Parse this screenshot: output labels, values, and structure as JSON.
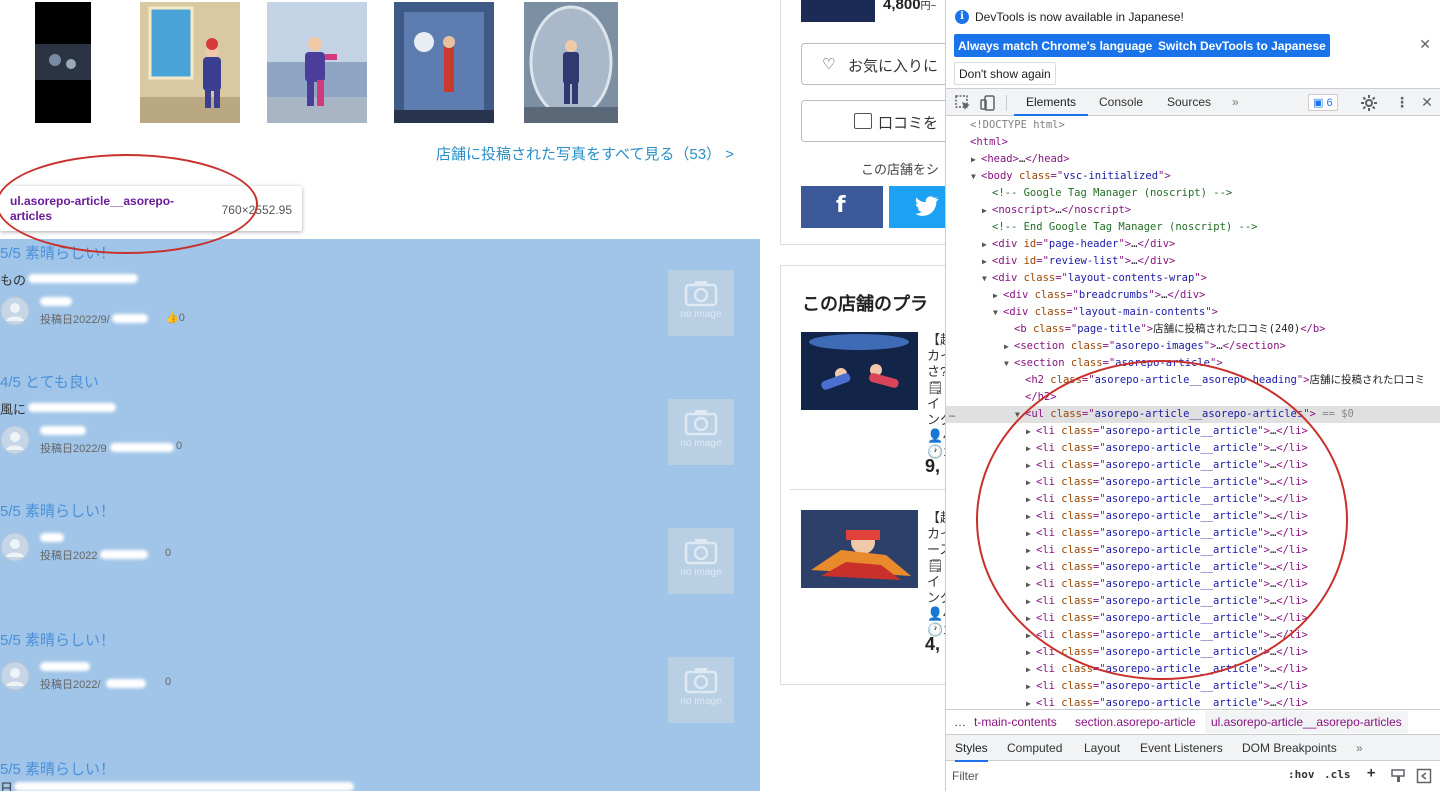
{
  "page": {
    "see_all_link": "店舗に投稿された写真をすべて見る（53） >",
    "price_top": "4,800",
    "price_top_unit": "円~",
    "favorite_button": "お気に入りに",
    "review_button": "口コミを",
    "share_label": "この店舗をシ",
    "plan_title": "この店舗のプラ",
    "plans": [
      {
        "lines": [
          "【超",
          "カイ",
          "さ?",
          "🗒イ",
          "ング",
          "👤4",
          "🕐1"
        ],
        "price": "9,"
      },
      {
        "lines": [
          "【超",
          "カイ",
          "ース",
          "🗒イ",
          "ング",
          "👤4",
          "🕐1"
        ],
        "price": "4,"
      }
    ],
    "no_image_label": "no image"
  },
  "tooltip": {
    "selector": "ul.asorepo-article__asorepo-articles",
    "dimensions": "760×2552.95"
  },
  "reviews": [
    {
      "rating": "5/5 素晴らしい！",
      "text": "もの",
      "posted": "投稿日2022/9/",
      "likes": "0"
    },
    {
      "rating": "4/5 とても良い",
      "text": "風に",
      "posted": "投稿日2022/9",
      "likes": "0"
    },
    {
      "rating": "5/5 素晴らしい！",
      "text": "",
      "posted": "投稿日2022",
      "likes": "0"
    },
    {
      "rating": "5/5 素晴らしい！",
      "text": "",
      "posted": "投稿日2022/",
      "likes": "0"
    },
    {
      "rating": "5/5 素晴らしい！",
      "text": "日",
      "posted": "",
      "likes": ""
    }
  ],
  "devtools": {
    "info_message": "DevTools is now available in Japanese!",
    "btn_match_language": "Always match Chrome's language",
    "btn_switch_japanese": "Switch DevTools to Japanese",
    "btn_dont_show": "Don't show again",
    "tabs": [
      "Elements",
      "Console",
      "Sources"
    ],
    "more_tabs": "»",
    "issues_count": "6",
    "dom_lines": [
      {
        "indent": 0,
        "tri": "",
        "parts": [
          [
            "doctype",
            "<!DOCTYPE html>"
          ]
        ]
      },
      {
        "indent": 0,
        "tri": "",
        "parts": [
          [
            "tag",
            "<html>"
          ]
        ]
      },
      {
        "indent": 1,
        "tri": "▶",
        "parts": [
          [
            "tag",
            "<head>"
          ],
          [
            "txt",
            "…"
          ],
          [
            "tag",
            "</head>"
          ]
        ]
      },
      {
        "indent": 1,
        "tri": "▼",
        "parts": [
          [
            "tag",
            "<body "
          ],
          [
            "attr",
            "class"
          ],
          [
            "tag",
            "=\""
          ],
          [
            "val",
            "vsc-initialized"
          ],
          [
            "tag",
            "\">"
          ]
        ]
      },
      {
        "indent": 2,
        "tri": "",
        "parts": [
          [
            "comment",
            "<!-- Google Tag Manager (noscript) -->"
          ]
        ]
      },
      {
        "indent": 2,
        "tri": "▶",
        "parts": [
          [
            "tag",
            "<noscript>"
          ],
          [
            "txt",
            "…"
          ],
          [
            "tag",
            "</noscript>"
          ]
        ]
      },
      {
        "indent": 2,
        "tri": "",
        "parts": [
          [
            "comment",
            "<!-- End Google Tag Manager (noscript) -->"
          ]
        ]
      },
      {
        "indent": 2,
        "tri": "▶",
        "parts": [
          [
            "tag",
            "<div "
          ],
          [
            "attr",
            "id"
          ],
          [
            "tag",
            "=\""
          ],
          [
            "val",
            "page-header"
          ],
          [
            "tag",
            "\">"
          ],
          [
            "txt",
            "…"
          ],
          [
            "tag",
            "</div>"
          ]
        ]
      },
      {
        "indent": 2,
        "tri": "▶",
        "parts": [
          [
            "tag",
            "<div "
          ],
          [
            "attr",
            "id"
          ],
          [
            "tag",
            "=\""
          ],
          [
            "val",
            "review-list"
          ],
          [
            "tag",
            "\">"
          ],
          [
            "txt",
            "…"
          ],
          [
            "tag",
            "</div>"
          ]
        ]
      },
      {
        "indent": 2,
        "tri": "▼",
        "parts": [
          [
            "tag",
            "<div "
          ],
          [
            "attr",
            "class"
          ],
          [
            "tag",
            "=\""
          ],
          [
            "val",
            "layout-contents-wrap"
          ],
          [
            "tag",
            "\">"
          ]
        ]
      },
      {
        "indent": 3,
        "tri": "▶",
        "parts": [
          [
            "tag",
            "<div "
          ],
          [
            "attr",
            "class"
          ],
          [
            "tag",
            "=\""
          ],
          [
            "val",
            "breadcrumbs"
          ],
          [
            "tag",
            "\">"
          ],
          [
            "txt",
            "…"
          ],
          [
            "tag",
            "</div>"
          ]
        ]
      },
      {
        "indent": 3,
        "tri": "▼",
        "parts": [
          [
            "tag",
            "<div "
          ],
          [
            "attr",
            "class"
          ],
          [
            "tag",
            "=\""
          ],
          [
            "val",
            "layout-main-contents"
          ],
          [
            "tag",
            "\">"
          ]
        ]
      },
      {
        "indent": 4,
        "tri": "",
        "parts": [
          [
            "tag",
            "<b "
          ],
          [
            "attr",
            "class"
          ],
          [
            "tag",
            "=\""
          ],
          [
            "val",
            "page-title"
          ],
          [
            "tag",
            "\">"
          ],
          [
            "txt",
            "店舗に投稿された口コミ(240)"
          ],
          [
            "tag",
            "</b>"
          ]
        ]
      },
      {
        "indent": 4,
        "tri": "▶",
        "parts": [
          [
            "tag",
            "<section "
          ],
          [
            "attr",
            "class"
          ],
          [
            "tag",
            "=\""
          ],
          [
            "val",
            "asorepo-images"
          ],
          [
            "tag",
            "\">"
          ],
          [
            "txt",
            "…"
          ],
          [
            "tag",
            "</section>"
          ]
        ]
      },
      {
        "indent": 4,
        "tri": "▼",
        "parts": [
          [
            "tag",
            "<section "
          ],
          [
            "attr",
            "class"
          ],
          [
            "tag",
            "=\""
          ],
          [
            "val",
            "asorepo-article"
          ],
          [
            "tag",
            "\">"
          ]
        ]
      },
      {
        "indent": 5,
        "tri": "",
        "parts": [
          [
            "tag",
            "<h2 "
          ],
          [
            "attr",
            "class"
          ],
          [
            "tag",
            "=\""
          ],
          [
            "val",
            "asorepo-article__asorepo-heading"
          ],
          [
            "tag",
            "\">"
          ],
          [
            "txt",
            "店舗に投稿された口コミ"
          ]
        ]
      },
      {
        "indent": 5,
        "tri": "",
        "parts": [
          [
            "tag",
            "</h2>"
          ]
        ]
      },
      {
        "indent": 5,
        "tri": "▼",
        "selected": true,
        "parts": [
          [
            "tag",
            "<ul "
          ],
          [
            "attr",
            "class"
          ],
          [
            "tag",
            "=\""
          ],
          [
            "val",
            "asorepo-article__asorepo-articles"
          ],
          [
            "tag",
            "\">"
          ],
          [
            "eq0",
            " == $0"
          ]
        ]
      },
      {
        "indent": 6,
        "tri": "▶",
        "parts": [
          [
            "tag",
            "<li "
          ],
          [
            "attr",
            "class"
          ],
          [
            "tag",
            "=\""
          ],
          [
            "val",
            "asorepo-article__article"
          ],
          [
            "tag",
            "\">"
          ],
          [
            "txt",
            "…"
          ],
          [
            "tag",
            "</li>"
          ]
        ]
      },
      {
        "indent": 6,
        "tri": "▶",
        "parts": [
          [
            "tag",
            "<li "
          ],
          [
            "attr",
            "class"
          ],
          [
            "tag",
            "=\""
          ],
          [
            "val",
            "asorepo-article__article"
          ],
          [
            "tag",
            "\">"
          ],
          [
            "txt",
            "…"
          ],
          [
            "tag",
            "</li>"
          ]
        ]
      },
      {
        "indent": 6,
        "tri": "▶",
        "parts": [
          [
            "tag",
            "<li "
          ],
          [
            "attr",
            "class"
          ],
          [
            "tag",
            "=\""
          ],
          [
            "val",
            "asorepo-article__article"
          ],
          [
            "tag",
            "\">"
          ],
          [
            "txt",
            "…"
          ],
          [
            "tag",
            "</li>"
          ]
        ]
      },
      {
        "indent": 6,
        "tri": "▶",
        "parts": [
          [
            "tag",
            "<li "
          ],
          [
            "attr",
            "class"
          ],
          [
            "tag",
            "=\""
          ],
          [
            "val",
            "asorepo-article__article"
          ],
          [
            "tag",
            "\">"
          ],
          [
            "txt",
            "…"
          ],
          [
            "tag",
            "</li>"
          ]
        ]
      },
      {
        "indent": 6,
        "tri": "▶",
        "parts": [
          [
            "tag",
            "<li "
          ],
          [
            "attr",
            "class"
          ],
          [
            "tag",
            "=\""
          ],
          [
            "val",
            "asorepo-article__article"
          ],
          [
            "tag",
            "\">"
          ],
          [
            "txt",
            "…"
          ],
          [
            "tag",
            "</li>"
          ]
        ]
      },
      {
        "indent": 6,
        "tri": "▶",
        "parts": [
          [
            "tag",
            "<li "
          ],
          [
            "attr",
            "class"
          ],
          [
            "tag",
            "=\""
          ],
          [
            "val",
            "asorepo-article__article"
          ],
          [
            "tag",
            "\">"
          ],
          [
            "txt",
            "…"
          ],
          [
            "tag",
            "</li>"
          ]
        ]
      },
      {
        "indent": 6,
        "tri": "▶",
        "parts": [
          [
            "tag",
            "<li "
          ],
          [
            "attr",
            "class"
          ],
          [
            "tag",
            "=\""
          ],
          [
            "val",
            "asorepo-article__article"
          ],
          [
            "tag",
            "\">"
          ],
          [
            "txt",
            "…"
          ],
          [
            "tag",
            "</li>"
          ]
        ]
      },
      {
        "indent": 6,
        "tri": "▶",
        "parts": [
          [
            "tag",
            "<li "
          ],
          [
            "attr",
            "class"
          ],
          [
            "tag",
            "=\""
          ],
          [
            "val",
            "asorepo-article__article"
          ],
          [
            "tag",
            "\">"
          ],
          [
            "txt",
            "…"
          ],
          [
            "tag",
            "</li>"
          ]
        ]
      },
      {
        "indent": 6,
        "tri": "▶",
        "parts": [
          [
            "tag",
            "<li "
          ],
          [
            "attr",
            "class"
          ],
          [
            "tag",
            "=\""
          ],
          [
            "val",
            "asorepo-article__article"
          ],
          [
            "tag",
            "\">"
          ],
          [
            "txt",
            "…"
          ],
          [
            "tag",
            "</li>"
          ]
        ]
      },
      {
        "indent": 6,
        "tri": "▶",
        "parts": [
          [
            "tag",
            "<li "
          ],
          [
            "attr",
            "class"
          ],
          [
            "tag",
            "=\""
          ],
          [
            "val",
            "asorepo-article__article"
          ],
          [
            "tag",
            "\">"
          ],
          [
            "txt",
            "…"
          ],
          [
            "tag",
            "</li>"
          ]
        ]
      },
      {
        "indent": 6,
        "tri": "▶",
        "parts": [
          [
            "tag",
            "<li "
          ],
          [
            "attr",
            "class"
          ],
          [
            "tag",
            "=\""
          ],
          [
            "val",
            "asorepo-article__article"
          ],
          [
            "tag",
            "\">"
          ],
          [
            "txt",
            "…"
          ],
          [
            "tag",
            "</li>"
          ]
        ]
      },
      {
        "indent": 6,
        "tri": "▶",
        "parts": [
          [
            "tag",
            "<li "
          ],
          [
            "attr",
            "class"
          ],
          [
            "tag",
            "=\""
          ],
          [
            "val",
            "asorepo-article__article"
          ],
          [
            "tag",
            "\">"
          ],
          [
            "txt",
            "…"
          ],
          [
            "tag",
            "</li>"
          ]
        ]
      },
      {
        "indent": 6,
        "tri": "▶",
        "parts": [
          [
            "tag",
            "<li "
          ],
          [
            "attr",
            "class"
          ],
          [
            "tag",
            "=\""
          ],
          [
            "val",
            "asorepo-article__article"
          ],
          [
            "tag",
            "\">"
          ],
          [
            "txt",
            "…"
          ],
          [
            "tag",
            "</li>"
          ]
        ]
      },
      {
        "indent": 6,
        "tri": "▶",
        "parts": [
          [
            "tag",
            "<li "
          ],
          [
            "attr",
            "class"
          ],
          [
            "tag",
            "=\""
          ],
          [
            "val",
            "asorepo-article__article"
          ],
          [
            "tag",
            "\">"
          ],
          [
            "txt",
            "…"
          ],
          [
            "tag",
            "</li>"
          ]
        ]
      },
      {
        "indent": 6,
        "tri": "▶",
        "parts": [
          [
            "tag",
            "<li "
          ],
          [
            "attr",
            "class"
          ],
          [
            "tag",
            "=\""
          ],
          [
            "val",
            "asorepo-article__article"
          ],
          [
            "tag",
            "\">"
          ],
          [
            "txt",
            "…"
          ],
          [
            "tag",
            "</li>"
          ]
        ]
      },
      {
        "indent": 6,
        "tri": "▶",
        "parts": [
          [
            "tag",
            "<li "
          ],
          [
            "attr",
            "class"
          ],
          [
            "tag",
            "=\""
          ],
          [
            "val",
            "asorepo-article__article"
          ],
          [
            "tag",
            "\">"
          ],
          [
            "txt",
            "…"
          ],
          [
            "tag",
            "</li>"
          ]
        ]
      },
      {
        "indent": 6,
        "tri": "▶",
        "parts": [
          [
            "tag",
            "<li "
          ],
          [
            "attr",
            "class"
          ],
          [
            "tag",
            "=\""
          ],
          [
            "val",
            "asorepo-article__article"
          ],
          [
            "tag",
            "\">"
          ],
          [
            "txt",
            "…"
          ],
          [
            "tag",
            "</li>"
          ]
        ]
      }
    ],
    "breadcrumbs": [
      "…",
      "t-main-contents",
      "section.asorepo-article",
      "ul.asorepo-article__asorepo-articles"
    ],
    "styles_tabs": [
      "Styles",
      "Computed",
      "Layout",
      "Event Listeners",
      "DOM Breakpoints"
    ],
    "styles_more": "»",
    "filter_placeholder": "Filter",
    "hov": ":hov",
    "cls": ".cls",
    "plus": "+"
  }
}
